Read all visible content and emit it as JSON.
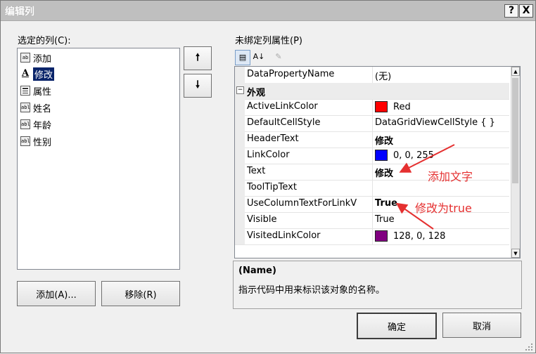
{
  "window": {
    "title": "编辑列",
    "help": "?",
    "close": "X"
  },
  "left": {
    "label": "选定的列(C):",
    "columns": [
      {
        "label": "添加",
        "icon": "button-column-icon"
      },
      {
        "label": "修改",
        "icon": "link-column-icon",
        "selected": true
      },
      {
        "label": "属性",
        "icon": "combobox-column-icon"
      },
      {
        "label": "姓名",
        "icon": "textbox-column-icon"
      },
      {
        "label": "年龄",
        "icon": "textbox-column-icon"
      },
      {
        "label": "性别",
        "icon": "textbox-column-icon"
      }
    ],
    "move_up": "🠕",
    "move_down": "🠗",
    "add_button": "添加(A)...",
    "remove_button": "移除(R)"
  },
  "right": {
    "label": "未绑定列属性(P)",
    "toolbar": {
      "categorized": "▤",
      "alphabetical": "A↓",
      "property_pages": "✎"
    },
    "rows": [
      {
        "name": "DataPropertyName",
        "value": "(无)"
      },
      {
        "category": true,
        "name": "外观",
        "toggle": "⊟"
      },
      {
        "name": "ActiveLinkColor",
        "value": "Red",
        "color": "#ff0000"
      },
      {
        "name": "DefaultCellStyle",
        "value": "DataGridViewCellStyle { }"
      },
      {
        "name": "HeaderText",
        "value": "修改",
        "bold": true
      },
      {
        "name": "LinkColor",
        "value": "0, 0, 255",
        "color": "#0000ff"
      },
      {
        "name": "Text",
        "value": "修改",
        "bold": true
      },
      {
        "name": "ToolTipText",
        "value": ""
      },
      {
        "name": "UseColumnTextForLinkV",
        "value": "True",
        "bold": true
      },
      {
        "name": "Visible",
        "value": "True"
      },
      {
        "name": "VisitedLinkColor",
        "value": "128, 0, 128",
        "color": "#800080"
      }
    ],
    "description": {
      "title": "(Name)",
      "text": "指示代码中用来标识该对象的名称。"
    }
  },
  "annotations": {
    "text_note": "添加文字",
    "true_note": "修改为true",
    "color": "#e53030"
  },
  "buttons": {
    "ok": "确定",
    "cancel": "取消"
  }
}
